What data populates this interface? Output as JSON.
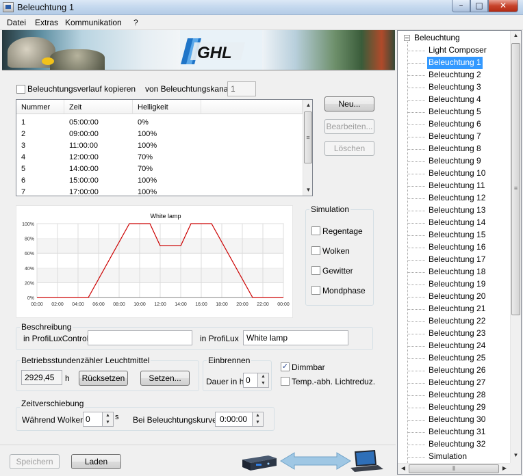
{
  "window": {
    "title": "Beleuchtung 1",
    "min": "–",
    "max": "□",
    "close": "✕"
  },
  "menu": [
    "Datei",
    "Extras",
    "Kommunikation",
    "?"
  ],
  "banner": {
    "logo": "GHL"
  },
  "copy": {
    "label": "Beleuchtungsverlauf kopieren",
    "checked": false,
    "kanal_label": "von Beleuchtungskanal",
    "kanal_value": "1"
  },
  "table": {
    "columns": [
      "Nummer",
      "Zeit",
      "Helligkeit"
    ],
    "rows": [
      [
        "1",
        "05:00:00",
        "0%"
      ],
      [
        "2",
        "09:00:00",
        "100%"
      ],
      [
        "3",
        "11:00:00",
        "100%"
      ],
      [
        "4",
        "12:00:00",
        "70%"
      ],
      [
        "5",
        "14:00:00",
        "70%"
      ],
      [
        "6",
        "15:00:00",
        "100%"
      ],
      [
        "7",
        "17:00:00",
        "100%"
      ]
    ]
  },
  "buttons": {
    "neu": "Neu...",
    "bearbeiten": "Bearbeiten...",
    "loeschen": "Löschen",
    "ruecksetzen": "Rücksetzen",
    "setzen": "Setzen...",
    "speichern": "Speichern",
    "laden": "Laden"
  },
  "chart_data": {
    "type": "line",
    "title": "White lamp",
    "x_hours": [
      0,
      5,
      9,
      11,
      12,
      14,
      15,
      17,
      21,
      24
    ],
    "y_percent": [
      0,
      0,
      100,
      100,
      70,
      70,
      100,
      100,
      0,
      0
    ],
    "xticks": [
      "00:00",
      "02:00",
      "04:00",
      "06:00",
      "08:00",
      "10:00",
      "12:00",
      "14:00",
      "16:00",
      "18:00",
      "20:00",
      "22:00",
      "00:00"
    ],
    "yticks": [
      "0%",
      "20%",
      "40%",
      "60%",
      "80%",
      "100%"
    ],
    "xlim": [
      0,
      24
    ],
    "ylim": [
      0,
      100
    ],
    "grid": true,
    "line_color": "#cc0000"
  },
  "simulation": {
    "title": "Simulation",
    "items": [
      {
        "label": "Regentage",
        "checked": false
      },
      {
        "label": "Wolken",
        "checked": false
      },
      {
        "label": "Gewitter",
        "checked": false
      },
      {
        "label": "Mondphase",
        "checked": false
      }
    ]
  },
  "beschreibung": {
    "title": "Beschreibung",
    "label_control": "in ProfiLuxControl",
    "value_control": "",
    "label_profilux": "in ProfiLux",
    "value_profilux": "White lamp"
  },
  "betrieb": {
    "title": "Betriebsstundenzähler Leuchtmittel",
    "value": "2929,45",
    "unit": "h"
  },
  "einbrennen": {
    "title": "Einbrennen",
    "label": "Dauer in h",
    "value": "0"
  },
  "dimmbar": {
    "label": "Dimmbar",
    "checked": true
  },
  "temp": {
    "label": "Temp.-abh. Lichtreduz.",
    "checked": false
  },
  "zeit": {
    "title": "Zeitverschiebung",
    "wolken_label": "Während Wolken",
    "wolken_value": "0",
    "wolken_unit": "s",
    "kurve_label": "Bei Beleuchtungskurve",
    "kurve_value": "0:00:00"
  },
  "tree": {
    "root": "Beleuchtung",
    "expander": "⊟",
    "items": [
      "Light Composer",
      "Beleuchtung 1",
      "Beleuchtung 2",
      "Beleuchtung 3",
      "Beleuchtung 4",
      "Beleuchtung 5",
      "Beleuchtung 6",
      "Beleuchtung 7",
      "Beleuchtung 8",
      "Beleuchtung 9",
      "Beleuchtung 10",
      "Beleuchtung 11",
      "Beleuchtung 12",
      "Beleuchtung 13",
      "Beleuchtung 14",
      "Beleuchtung 15",
      "Beleuchtung 16",
      "Beleuchtung 17",
      "Beleuchtung 18",
      "Beleuchtung 19",
      "Beleuchtung 20",
      "Beleuchtung 21",
      "Beleuchtung 22",
      "Beleuchtung 23",
      "Beleuchtung 24",
      "Beleuchtung 25",
      "Beleuchtung 26",
      "Beleuchtung 27",
      "Beleuchtung 28",
      "Beleuchtung 29",
      "Beleuchtung 30",
      "Beleuchtung 31",
      "Beleuchtung 32",
      "Simulation"
    ],
    "selected": "Beleuchtung 1"
  },
  "icons": {
    "check": "✓",
    "up": "▲",
    "down": "▼",
    "left": "◀",
    "right": "▶",
    "grip": "≡",
    "hgrip": "⦀"
  },
  "colors": {
    "selection": "#3399ff",
    "curve": "#cc0000",
    "arrow": "#9fc7e4"
  }
}
